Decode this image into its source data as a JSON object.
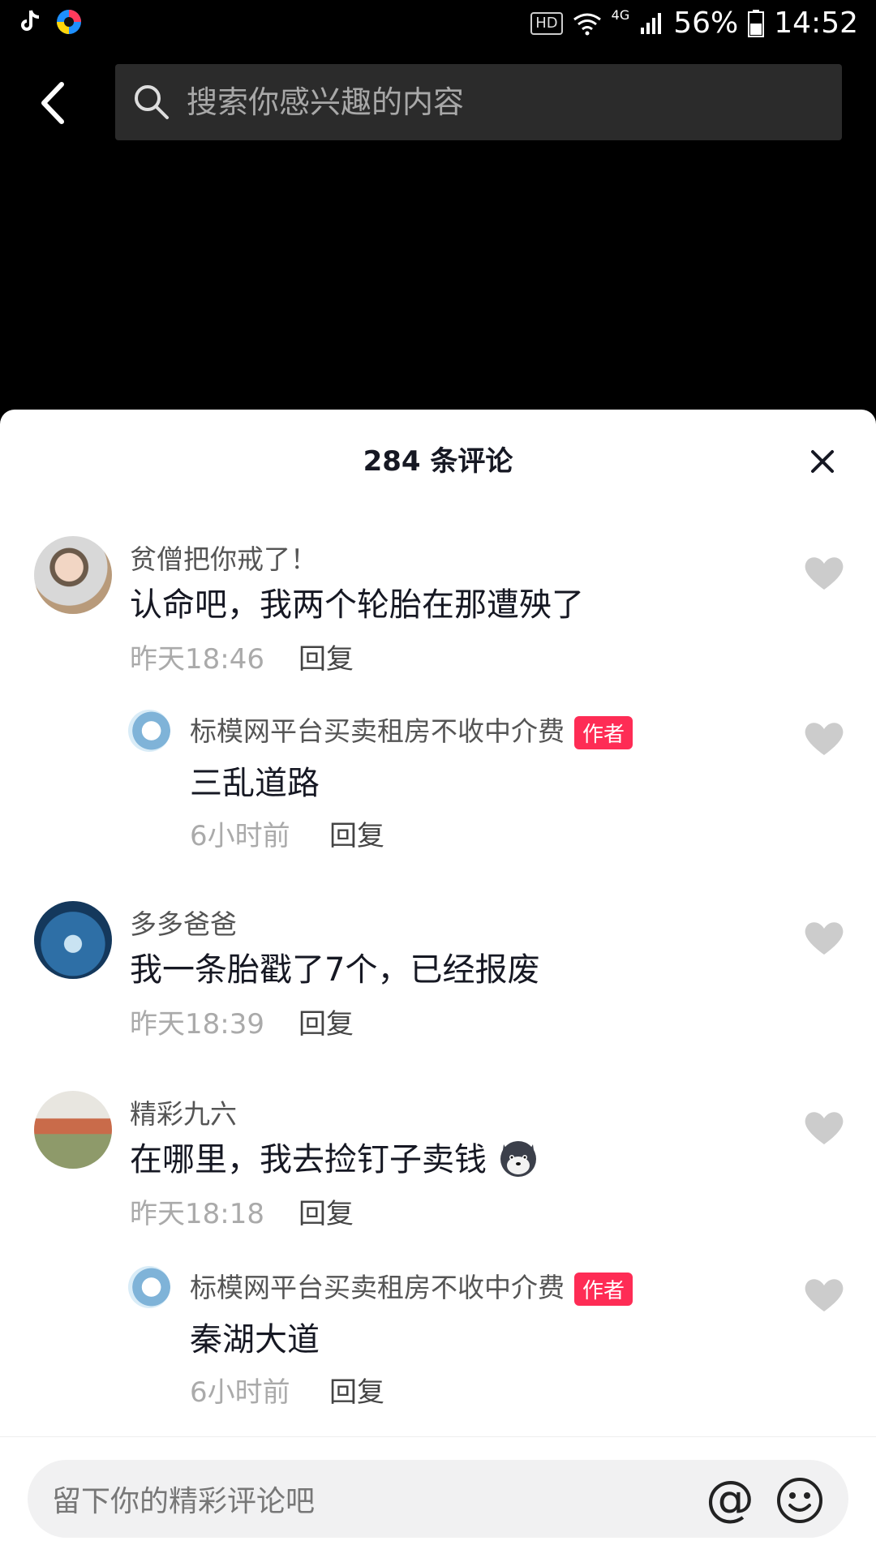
{
  "statusbar": {
    "hd": "HD",
    "network": "4G",
    "battery": "56%",
    "time": "14:52"
  },
  "search": {
    "placeholder": "搜索你感兴趣的内容"
  },
  "sheet": {
    "title": "284 条评论"
  },
  "comments": [
    {
      "user": "贫僧把你戒了！",
      "text": "认命吧，我两个轮胎在那遭殃了",
      "time": "昨天18:46",
      "reply": "回复"
    },
    {
      "user": "标模网平台买卖租房不收中介费",
      "badge": "作者",
      "text": "三乱道路",
      "time": "6小时前",
      "reply": "回复"
    },
    {
      "user": "多多爸爸",
      "text": "我一条胎戳了7个，已经报废",
      "time": "昨天18:39",
      "reply": "回复"
    },
    {
      "user": "精彩九六",
      "text": "在哪里，我去捡钉子卖钱",
      "time": "昨天18:18",
      "reply": "回复"
    },
    {
      "user": "标模网平台买卖租房不收中介费",
      "badge": "作者",
      "text": "秦湖大道",
      "time": "6小时前",
      "reply": "回复"
    }
  ],
  "composer": {
    "placeholder": "留下你的精彩评论吧",
    "at": "@"
  },
  "colors": {
    "accent": "#fe2c55",
    "sheet_bg": "#ffffff",
    "page_bg": "#000000"
  }
}
